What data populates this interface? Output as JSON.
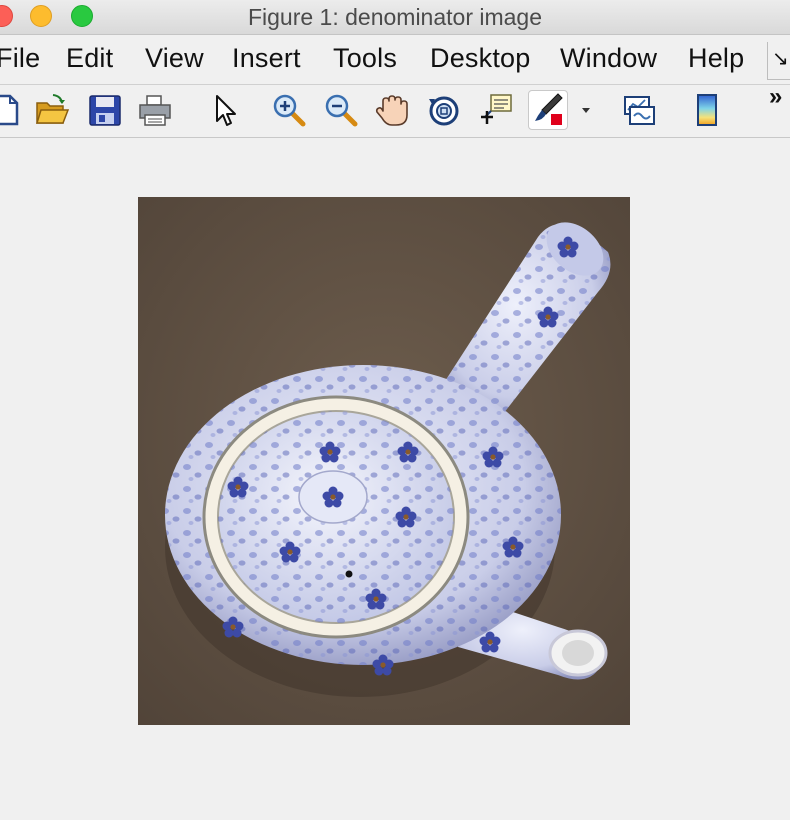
{
  "window": {
    "title": "Figure 1: denominator image"
  },
  "menu": {
    "items": [
      "File",
      "Edit",
      "View",
      "Insert",
      "Tools",
      "Desktop",
      "Window",
      "Help"
    ],
    "dock_glyph": "↘"
  },
  "toolbar": {
    "buttons": [
      "new-figure-icon",
      "open-file-icon",
      "save-icon",
      "print-icon",
      "edit-plot-arrow-icon",
      "zoom-in-icon",
      "zoom-out-icon",
      "pan-hand-icon",
      "rotate-3d-icon",
      "data-cursor-icon",
      "brush-icon",
      "brush-dropdown-icon",
      "link-plot-icon",
      "insert-colorbar-icon"
    ],
    "overflow": "»",
    "brush_color": "#e0001b"
  },
  "figure": {
    "image_subject": "blue-and-white floral teapot viewed from above on a brown background"
  }
}
